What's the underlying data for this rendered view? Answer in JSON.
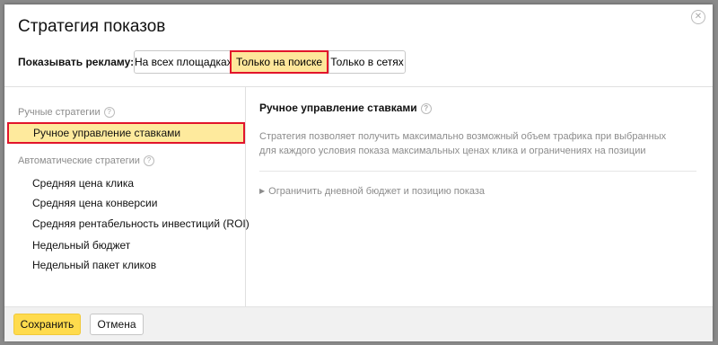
{
  "dialog": {
    "title": "Стратегия показов",
    "close_icon": "close-icon"
  },
  "show_ads": {
    "label": "Показывать рекламу:",
    "options": [
      "На всех площадках",
      "Только на поиске",
      "Только в сетях"
    ],
    "selected": "Только на поиске"
  },
  "left_panel": {
    "manual_header": "Ручные стратегии",
    "manual_items": [
      "Ручное управление ставками"
    ],
    "auto_header": "Автоматические стратегии",
    "auto_items": [
      "Средняя цена клика",
      "Средняя цена конверсии",
      "Средняя рентабельность инвестиций (ROI)",
      "Недельный бюджет",
      "Недельный пакет кликов"
    ],
    "help_icon": "question-circle-icon"
  },
  "right_panel": {
    "title": "Ручное управление ставками",
    "description": "Стратегия позволяет получить максимально возможный объем трафика при выбранных для каждого условия показа максимальных ценах клика и ограничениях на позиции",
    "expander": "Ограничить дневной бюджет и позицию показа",
    "expander_icon": "triangle-right-icon"
  },
  "footer": {
    "save": "Сохранить",
    "cancel": "Отмена"
  },
  "colors": {
    "highlight": "#fee69a",
    "outline": "#e2142b",
    "save_button": "#ffdb4d"
  }
}
